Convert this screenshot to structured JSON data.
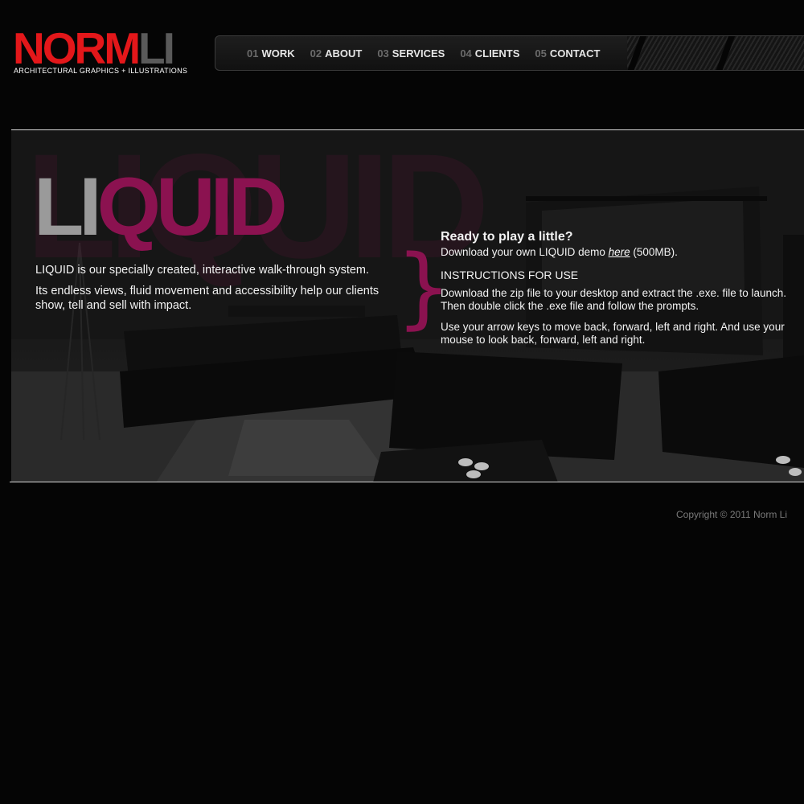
{
  "brand": {
    "logo_part1": "NORM",
    "logo_part2": "LI",
    "tagline": "ARCHITECTURAL GRAPHICS + ILLUSTRATIONS",
    "colors": {
      "red": "#e3171a",
      "gray": "#5a5a5a"
    }
  },
  "nav": {
    "items": [
      {
        "num": "01",
        "label": "WORK"
      },
      {
        "num": "02",
        "label": "ABOUT"
      },
      {
        "num": "03",
        "label": "SERVICES"
      },
      {
        "num": "04",
        "label": "CLIENTS"
      },
      {
        "num": "05",
        "label": "CONTACT"
      }
    ]
  },
  "hero": {
    "watermark": "LIQUID",
    "logo_part1": "LI",
    "logo_part2": "QUID",
    "accent_color": "#8b1250",
    "intro_1": "LIQUID is our specially created, interactive walk-through system.",
    "intro_2": "Its endless views, fluid movement and accessibility help our clients show, tell and sell with impact.",
    "brace": "}",
    "cta_heading": "Ready to play a little?",
    "download_prefix": "Download your own LIQUID demo ",
    "download_link": "here",
    "download_suffix": " (500MB).",
    "instructions_title": "INSTRUCTIONS FOR USE",
    "instructions_1": "Download the zip file to your desktop and extract the .exe. file to launch. Then double click the .exe file and follow the prompts.",
    "instructions_2": "Use your arrow keys to move back, forward, left and right. And use your mouse to look back, forward, left and right."
  },
  "footer": {
    "copyright": "Copyright © 2011 Norm Li"
  }
}
